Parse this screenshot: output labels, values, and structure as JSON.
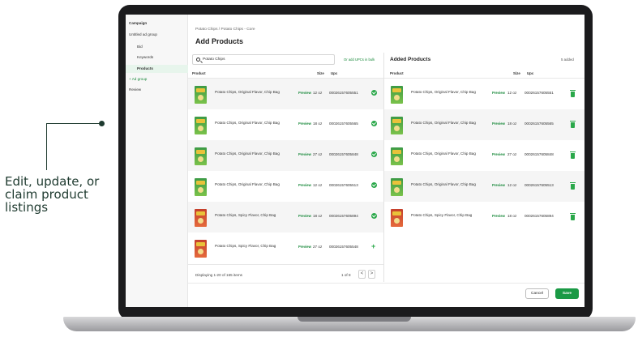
{
  "callout": {
    "text": "Edit, update, or claim product listings"
  },
  "sidebar": {
    "items": [
      {
        "label": "Campaign"
      },
      {
        "label": "Untitled ad group"
      },
      {
        "label": "Bid"
      },
      {
        "label": "Keywords"
      },
      {
        "label": "Products"
      },
      {
        "label": "+ Ad group"
      },
      {
        "label": "Review"
      }
    ]
  },
  "header": {
    "breadcrumb": "Potato Chips / Potato Chips - Core",
    "title": "Add Products"
  },
  "search": {
    "value": "Potato Chips",
    "bulk_link": "Or add UPCs in bulk"
  },
  "left_table": {
    "headers": {
      "product": "Product",
      "size": "Size",
      "upc": "Upc"
    },
    "rows": [
      {
        "name": "Potato Chips, Original Flavor, Chip Bag",
        "preview": "Preview",
        "size": "12 oz",
        "upc": "00026157605551",
        "status": "added",
        "pack": "green"
      },
      {
        "name": "Potato Chips, Original Flavor, Chip Bag",
        "preview": "Preview",
        "size": "18 oz",
        "upc": "00026157605565",
        "status": "added",
        "pack": "green"
      },
      {
        "name": "Potato Chips, Original Flavor, Chip Bag",
        "preview": "Preview",
        "size": "27 oz",
        "upc": "00026157605848",
        "status": "added",
        "pack": "green"
      },
      {
        "name": "Potato Chips, Original Flavor, Chip Bag",
        "preview": "Preview",
        "size": "12 oz",
        "upc": "00026157605513",
        "status": "added",
        "pack": "green"
      },
      {
        "name": "Potato Chips, Spicy Flavor, Chip Bag",
        "preview": "Preview",
        "size": "18 oz",
        "upc": "00026157605894",
        "status": "added",
        "pack": "red"
      },
      {
        "name": "Potato Chips, Spicy Flavor, Chip Bag",
        "preview": "Preview",
        "size": "27 oz",
        "upc": "00026157605548",
        "status": "add",
        "pack": "red"
      }
    ]
  },
  "right_table": {
    "title": "Added Products",
    "count": "5 added",
    "headers": {
      "product": "Product",
      "size": "Size",
      "upc": "Upc"
    },
    "rows": [
      {
        "name": "Potato Chips, Original Flavor, Chip Bag",
        "preview": "Preview",
        "size": "12 oz",
        "upc": "00026157605551",
        "pack": "green"
      },
      {
        "name": "Potato Chips, Original Flavor, Chip Bag",
        "preview": "Preview",
        "size": "18 oz",
        "upc": "00026157605565",
        "pack": "green"
      },
      {
        "name": "Potato Chips, Original Flavor, Chip Bag",
        "preview": "Preview",
        "size": "27 oz",
        "upc": "00026157605848",
        "pack": "green"
      },
      {
        "name": "Potato Chips, Original Flavor, Chip Bag",
        "preview": "Preview",
        "size": "12 oz",
        "upc": "00026157605513",
        "pack": "green"
      },
      {
        "name": "Potato Chips, Spicy Flavor, Chip Bag",
        "preview": "Preview",
        "size": "18 oz",
        "upc": "00026157605894",
        "pack": "red"
      }
    ]
  },
  "footer": {
    "displaying": "Displaying 1-20 of 165 items",
    "page": "1 of 8",
    "prev": "<",
    "next": ">"
  },
  "actions": {
    "cancel": "Cancel",
    "save": "Save"
  },
  "colors": {
    "accent": "#1a9a45",
    "link": "#1a8a3c",
    "bezel": "#1b1b1d"
  }
}
